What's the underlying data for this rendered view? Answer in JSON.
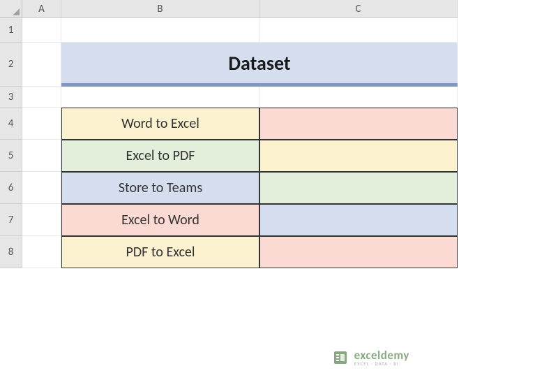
{
  "columns": [
    "A",
    "B",
    "C"
  ],
  "rows": [
    "1",
    "2",
    "3",
    "4",
    "5",
    "6",
    "7",
    "8"
  ],
  "title": "Dataset",
  "table": {
    "rows": [
      {
        "b": "Word to Excel",
        "c": "",
        "b_color": "bg-cream",
        "c_color": "bg-peach"
      },
      {
        "b": "Excel to PDF",
        "c": "",
        "b_color": "bg-green",
        "c_color": "bg-cream"
      },
      {
        "b": "Store to Teams",
        "c": "",
        "b_color": "bg-blue",
        "c_color": "bg-green"
      },
      {
        "b": "Excel to Word",
        "c": "",
        "b_color": "bg-peach",
        "c_color": "bg-blue"
      },
      {
        "b": "PDF to Excel",
        "c": "",
        "b_color": "bg-cream",
        "c_color": "bg-peach"
      }
    ]
  },
  "watermark": {
    "brand": "exceldemy",
    "tagline": "EXCEL · DATA · BI"
  }
}
